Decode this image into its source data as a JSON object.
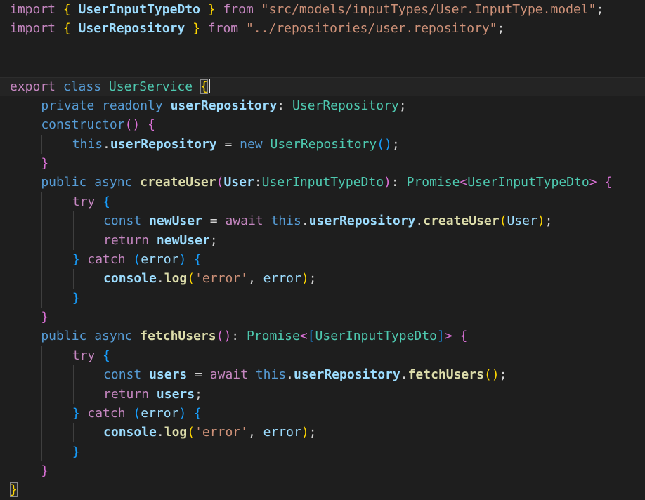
{
  "editor": {
    "colors": {
      "bg": "#1e1e1e",
      "lineHighlight": "#242424",
      "keyword": "#569cd6",
      "control": "#c586c0",
      "type": "#4ec9b0",
      "func": "#dcdcaa",
      "variable": "#9cdcfe",
      "string": "#ce9178",
      "punct": "#d4d4d4",
      "bracket1": "#ffd700",
      "bracket2": "#da70d6",
      "bracket3": "#179fff",
      "guide": "#3f3f3f",
      "guideActive": "#5a5a5a",
      "cursor": "#e8e8e8",
      "matchBorder": "#8c8c8c"
    },
    "lines": [
      {
        "ind": 0,
        "tokens": [
          {
            "t": "import ",
            "c": "kc"
          },
          {
            "t": "{",
            "c": "b1"
          },
          {
            "t": " UserInputTypeDto ",
            "c": "vb"
          },
          {
            "t": "}",
            "c": "b1"
          },
          {
            "t": " from ",
            "c": "kc"
          },
          {
            "t": "\"src/models/inputTypes/User.InputType.model\"",
            "c": "s"
          },
          {
            "t": ";",
            "c": "p"
          }
        ]
      },
      {
        "ind": 0,
        "tokens": [
          {
            "t": "import ",
            "c": "kc"
          },
          {
            "t": "{",
            "c": "b1"
          },
          {
            "t": " UserRepository ",
            "c": "vb"
          },
          {
            "t": "}",
            "c": "b1"
          },
          {
            "t": " from ",
            "c": "kc"
          },
          {
            "t": "\"../repositories/user.repository\"",
            "c": "s"
          },
          {
            "t": ";",
            "c": "p"
          }
        ]
      },
      {
        "ind": 0,
        "tokens": []
      },
      {
        "ind": 0,
        "tokens": []
      },
      {
        "ind": 0,
        "hl": true,
        "cursor": true,
        "tokens": [
          {
            "t": "export ",
            "c": "kc"
          },
          {
            "t": "class ",
            "c": "k"
          },
          {
            "t": "UserService ",
            "c": "ty"
          },
          {
            "t": "{",
            "c": "b1 m"
          }
        ]
      },
      {
        "ind": 4,
        "tokens": [
          {
            "t": "private readonly ",
            "c": "k"
          },
          {
            "t": "userRepository",
            "c": "vb"
          },
          {
            "t": ": ",
            "c": "p"
          },
          {
            "t": "UserRepository",
            "c": "ty"
          },
          {
            "t": ";",
            "c": "p"
          }
        ]
      },
      {
        "ind": 4,
        "tokens": [
          {
            "t": "constructor",
            "c": "k"
          },
          {
            "t": "()",
            "c": "b2"
          },
          {
            "t": " ",
            "c": "p"
          },
          {
            "t": "{",
            "c": "b2"
          }
        ]
      },
      {
        "ind": 8,
        "tokens": [
          {
            "t": "this",
            "c": "k"
          },
          {
            "t": ".",
            "c": "p"
          },
          {
            "t": "userRepository",
            "c": "vb"
          },
          {
            "t": " = ",
            "c": "p"
          },
          {
            "t": "new ",
            "c": "k"
          },
          {
            "t": "UserRepository",
            "c": "ty"
          },
          {
            "t": "()",
            "c": "b3"
          },
          {
            "t": ";",
            "c": "p"
          }
        ]
      },
      {
        "ind": 4,
        "tokens": [
          {
            "t": "}",
            "c": "b2"
          }
        ]
      },
      {
        "ind": 4,
        "tokens": [
          {
            "t": "public async ",
            "c": "k"
          },
          {
            "t": "createUser",
            "c": "fn"
          },
          {
            "t": "(",
            "c": "b2"
          },
          {
            "t": "User",
            "c": "vb"
          },
          {
            "t": ":",
            "c": "p"
          },
          {
            "t": "UserInputTypeDto",
            "c": "ty"
          },
          {
            "t": ")",
            "c": "b2"
          },
          {
            "t": ": ",
            "c": "p"
          },
          {
            "t": "Promise",
            "c": "ty"
          },
          {
            "t": "<",
            "c": "b2"
          },
          {
            "t": "UserInputTypeDto",
            "c": "ty"
          },
          {
            "t": ">",
            "c": "b2"
          },
          {
            "t": " ",
            "c": "p"
          },
          {
            "t": "{",
            "c": "b2"
          }
        ]
      },
      {
        "ind": 8,
        "tokens": [
          {
            "t": "try ",
            "c": "kc"
          },
          {
            "t": "{",
            "c": "b3"
          }
        ]
      },
      {
        "ind": 12,
        "tokens": [
          {
            "t": "const ",
            "c": "k"
          },
          {
            "t": "newUser",
            "c": "vb"
          },
          {
            "t": " = ",
            "c": "p"
          },
          {
            "t": "await ",
            "c": "kc"
          },
          {
            "t": "this",
            "c": "k"
          },
          {
            "t": ".",
            "c": "p"
          },
          {
            "t": "userRepository",
            "c": "vb"
          },
          {
            "t": ".",
            "c": "p"
          },
          {
            "t": "createUser",
            "c": "fn"
          },
          {
            "t": "(",
            "c": "b1"
          },
          {
            "t": "User",
            "c": "v"
          },
          {
            "t": ")",
            "c": "b1"
          },
          {
            "t": ";",
            "c": "p"
          }
        ]
      },
      {
        "ind": 12,
        "tokens": [
          {
            "t": "return ",
            "c": "kc"
          },
          {
            "t": "newUser",
            "c": "vb"
          },
          {
            "t": ";",
            "c": "p"
          }
        ]
      },
      {
        "ind": 8,
        "tokens": [
          {
            "t": "}",
            "c": "b3"
          },
          {
            "t": " ",
            "c": "p"
          },
          {
            "t": "catch ",
            "c": "kc"
          },
          {
            "t": "(",
            "c": "b3"
          },
          {
            "t": "error",
            "c": "v"
          },
          {
            "t": ")",
            "c": "b3"
          },
          {
            "t": " ",
            "c": "p"
          },
          {
            "t": "{",
            "c": "b3"
          }
        ]
      },
      {
        "ind": 12,
        "tokens": [
          {
            "t": "console",
            "c": "vb"
          },
          {
            "t": ".",
            "c": "p"
          },
          {
            "t": "log",
            "c": "fn"
          },
          {
            "t": "(",
            "c": "b1"
          },
          {
            "t": "'error'",
            "c": "s"
          },
          {
            "t": ", ",
            "c": "p"
          },
          {
            "t": "error",
            "c": "v"
          },
          {
            "t": ")",
            "c": "b1"
          },
          {
            "t": ";",
            "c": "p"
          }
        ]
      },
      {
        "ind": 8,
        "tokens": [
          {
            "t": "}",
            "c": "b3"
          }
        ]
      },
      {
        "ind": 4,
        "tokens": [
          {
            "t": "}",
            "c": "b2"
          }
        ]
      },
      {
        "ind": 4,
        "tokens": [
          {
            "t": "public async ",
            "c": "k"
          },
          {
            "t": "fetchUsers",
            "c": "fn"
          },
          {
            "t": "()",
            "c": "b2"
          },
          {
            "t": ": ",
            "c": "p"
          },
          {
            "t": "Promise",
            "c": "ty"
          },
          {
            "t": "<",
            "c": "b2"
          },
          {
            "t": "[",
            "c": "b3"
          },
          {
            "t": "UserInputTypeDto",
            "c": "ty"
          },
          {
            "t": "]",
            "c": "b3"
          },
          {
            "t": ">",
            "c": "b2"
          },
          {
            "t": " ",
            "c": "p"
          },
          {
            "t": "{",
            "c": "b2"
          }
        ]
      },
      {
        "ind": 8,
        "tokens": [
          {
            "t": "try ",
            "c": "kc"
          },
          {
            "t": "{",
            "c": "b3"
          }
        ]
      },
      {
        "ind": 12,
        "tokens": [
          {
            "t": "const ",
            "c": "k"
          },
          {
            "t": "users",
            "c": "vb"
          },
          {
            "t": " = ",
            "c": "p"
          },
          {
            "t": "await ",
            "c": "kc"
          },
          {
            "t": "this",
            "c": "k"
          },
          {
            "t": ".",
            "c": "p"
          },
          {
            "t": "userRepository",
            "c": "vb"
          },
          {
            "t": ".",
            "c": "p"
          },
          {
            "t": "fetchUsers",
            "c": "fn"
          },
          {
            "t": "()",
            "c": "b1"
          },
          {
            "t": ";",
            "c": "p"
          }
        ]
      },
      {
        "ind": 12,
        "tokens": [
          {
            "t": "return ",
            "c": "kc"
          },
          {
            "t": "users",
            "c": "vb"
          },
          {
            "t": ";",
            "c": "p"
          }
        ]
      },
      {
        "ind": 8,
        "tokens": [
          {
            "t": "}",
            "c": "b3"
          },
          {
            "t": " ",
            "c": "p"
          },
          {
            "t": "catch ",
            "c": "kc"
          },
          {
            "t": "(",
            "c": "b3"
          },
          {
            "t": "error",
            "c": "v"
          },
          {
            "t": ")",
            "c": "b3"
          },
          {
            "t": " ",
            "c": "p"
          },
          {
            "t": "{",
            "c": "b3"
          }
        ]
      },
      {
        "ind": 12,
        "tokens": [
          {
            "t": "console",
            "c": "vb"
          },
          {
            "t": ".",
            "c": "p"
          },
          {
            "t": "log",
            "c": "fn"
          },
          {
            "t": "(",
            "c": "b1"
          },
          {
            "t": "'error'",
            "c": "s"
          },
          {
            "t": ", ",
            "c": "p"
          },
          {
            "t": "error",
            "c": "v"
          },
          {
            "t": ")",
            "c": "b1"
          },
          {
            "t": ";",
            "c": "p"
          }
        ]
      },
      {
        "ind": 8,
        "tokens": [
          {
            "t": "}",
            "c": "b3"
          }
        ]
      },
      {
        "ind": 4,
        "tokens": [
          {
            "t": "}",
            "c": "b2"
          }
        ]
      },
      {
        "ind": 0,
        "tokens": [
          {
            "t": "}",
            "c": "b1 m"
          }
        ]
      }
    ]
  }
}
